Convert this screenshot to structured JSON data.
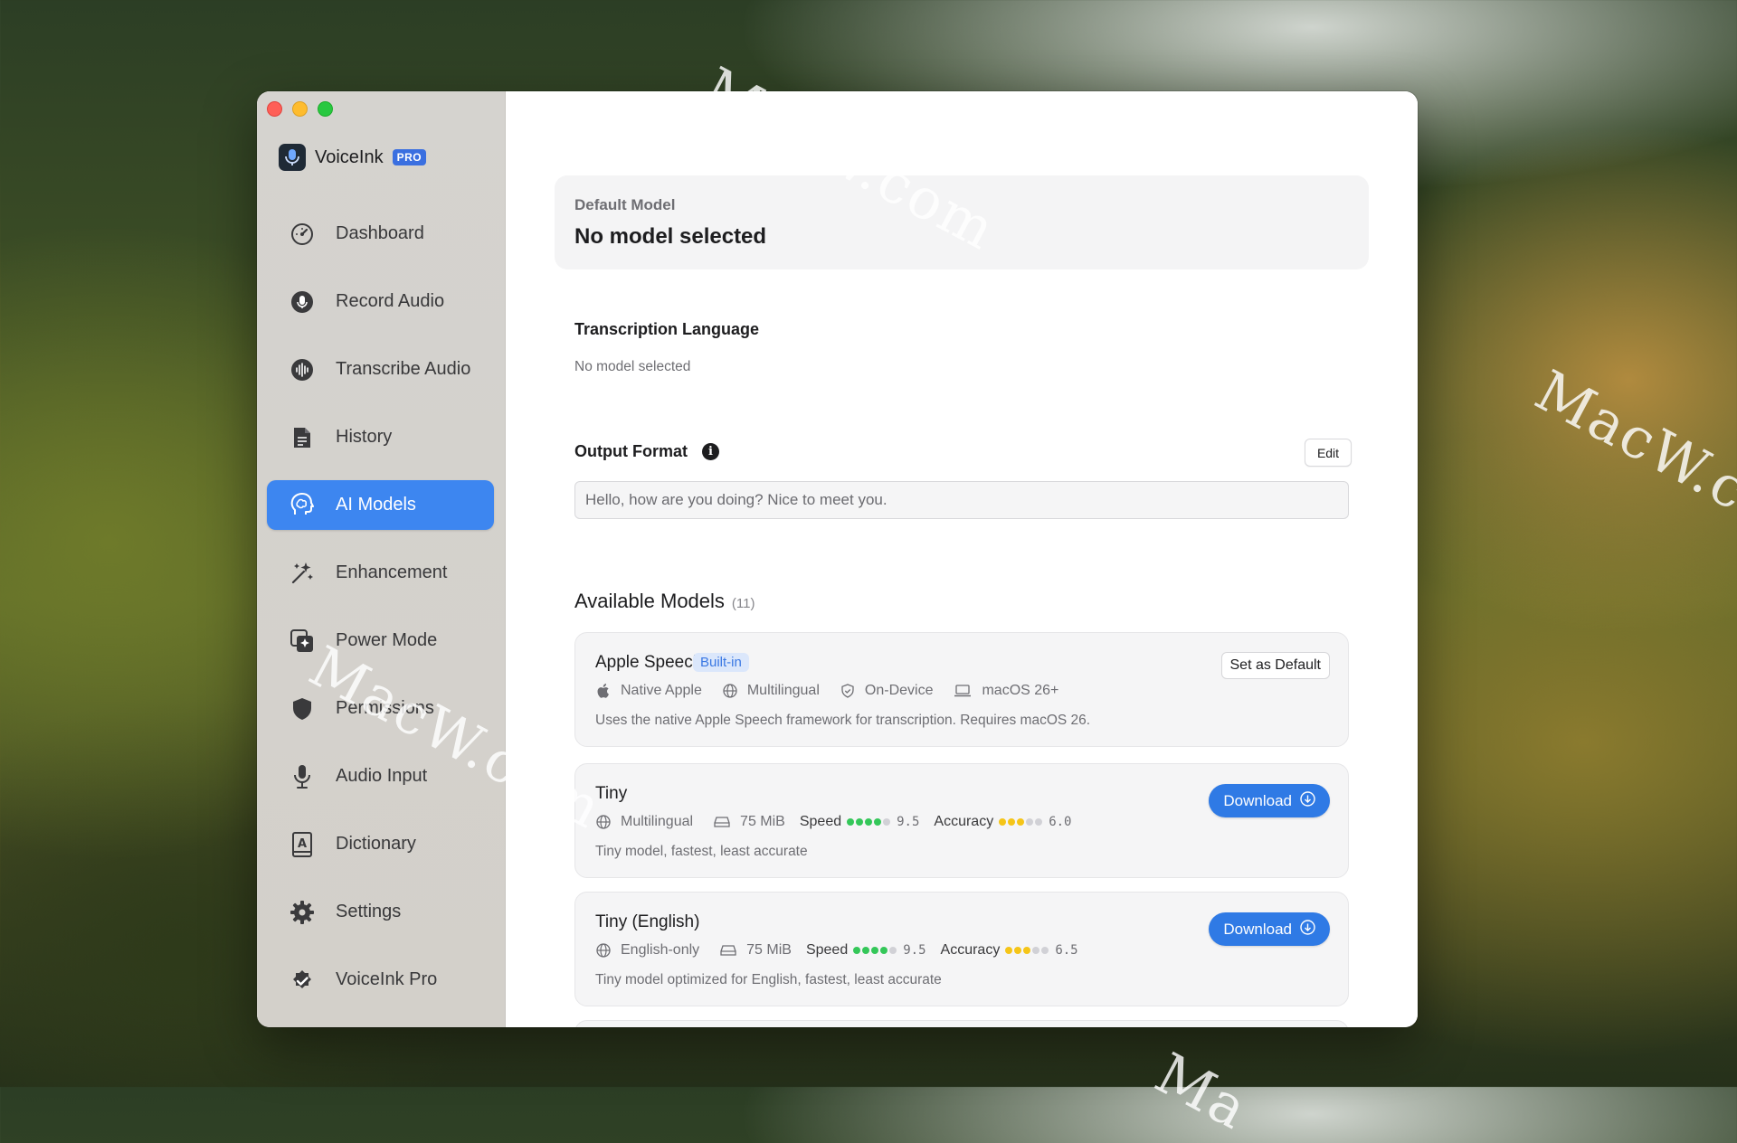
{
  "watermarks": [
    "MacW.com",
    "MacW.co",
    "MacW.com",
    "Ma"
  ],
  "app": {
    "name": "VoiceInk",
    "badge": "PRO"
  },
  "sidebar": {
    "items": [
      {
        "label": "Dashboard",
        "icon": "gauge-icon"
      },
      {
        "label": "Record Audio",
        "icon": "microphone-circle-icon"
      },
      {
        "label": "Transcribe Audio",
        "icon": "waveform-circle-icon"
      },
      {
        "label": "History",
        "icon": "document-icon"
      },
      {
        "label": "AI Models",
        "icon": "brain-head-icon",
        "active": true
      },
      {
        "label": "Enhancement",
        "icon": "sparkles-icon"
      },
      {
        "label": "Power Mode",
        "icon": "sparkle-square-icon"
      },
      {
        "label": "Permissions",
        "icon": "shield-icon"
      },
      {
        "label": "Audio Input",
        "icon": "microphone-icon"
      },
      {
        "label": "Dictionary",
        "icon": "book-icon"
      },
      {
        "label": "Settings",
        "icon": "gear-icon"
      },
      {
        "label": "VoiceInk Pro",
        "icon": "checkmark-seal-icon"
      }
    ]
  },
  "default_model": {
    "label": "Default Model",
    "value": "No model selected"
  },
  "transcription_language": {
    "title": "Transcription Language",
    "value": "No model selected"
  },
  "output_format": {
    "title": "Output Format",
    "info_icon": "info-icon",
    "edit_label": "Edit",
    "example": "Hello, how are you doing? Nice to meet you."
  },
  "available_models": {
    "title": "Available Models",
    "count": "(11)",
    "models": [
      {
        "name": "Apple Speech",
        "badge": "Built-in",
        "meta": [
          "Native Apple",
          "Multilingual",
          "On-Device",
          "macOS 26+"
        ],
        "description": "Uses the native Apple Speech framework for transcription. Requires macOS 26.",
        "action": "Set as Default"
      },
      {
        "name": "Tiny",
        "language": "Multilingual",
        "size": "75 MiB",
        "speed_label": "Speed",
        "speed": "9.5",
        "speed_dots": 4,
        "accuracy_label": "Accuracy",
        "accuracy": "6.0",
        "accuracy_dots": 3,
        "description": "Tiny model, fastest, least accurate",
        "action": "Download"
      },
      {
        "name": "Tiny (English)",
        "language": "English-only",
        "size": "75 MiB",
        "speed_label": "Speed",
        "speed": "9.5",
        "speed_dots": 4,
        "accuracy_label": "Accuracy",
        "accuracy": "6.5",
        "accuracy_dots": 3,
        "description": "Tiny model optimized for English, fastest, least accurate",
        "action": "Download"
      }
    ]
  },
  "colors": {
    "accent": "#3d86f0",
    "download": "#2f7ae5",
    "speed_dot": "#34c759",
    "accuracy_dot": "#f5c518",
    "dot_empty": "#d1d1d6"
  }
}
